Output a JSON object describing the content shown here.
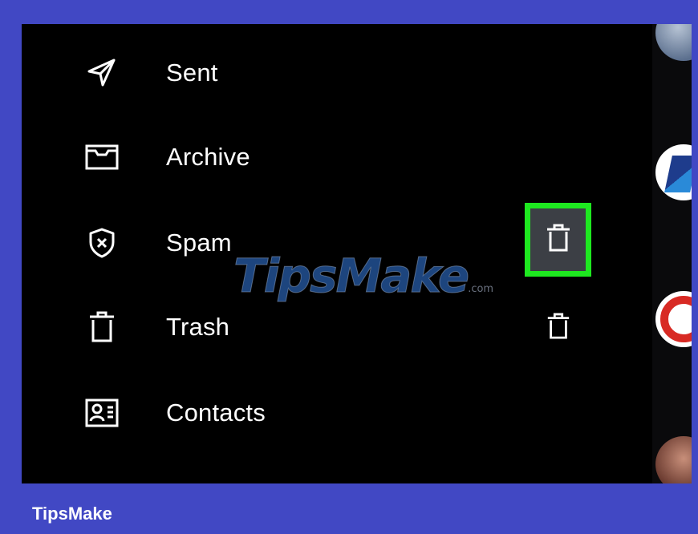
{
  "menu": {
    "items": [
      {
        "label": "Sent",
        "icon": "send-icon"
      },
      {
        "label": "Archive",
        "icon": "archive-icon"
      },
      {
        "label": "Spam",
        "icon": "spam-shield-icon"
      },
      {
        "label": "Trash",
        "icon": "trash-icon"
      },
      {
        "label": "Contacts",
        "icon": "contacts-card-icon"
      }
    ]
  },
  "actions": {
    "highlighted_delete_icon": "trash-icon",
    "delete_icon": "trash-icon"
  },
  "watermark": {
    "text": "TipsMake",
    "suffix": ".com"
  },
  "footer": {
    "brand": "TipsMake"
  },
  "colors": {
    "background_frame": "#4148c4",
    "screen": "#000000",
    "highlight": "#1ee820",
    "text": "#ffffff"
  }
}
